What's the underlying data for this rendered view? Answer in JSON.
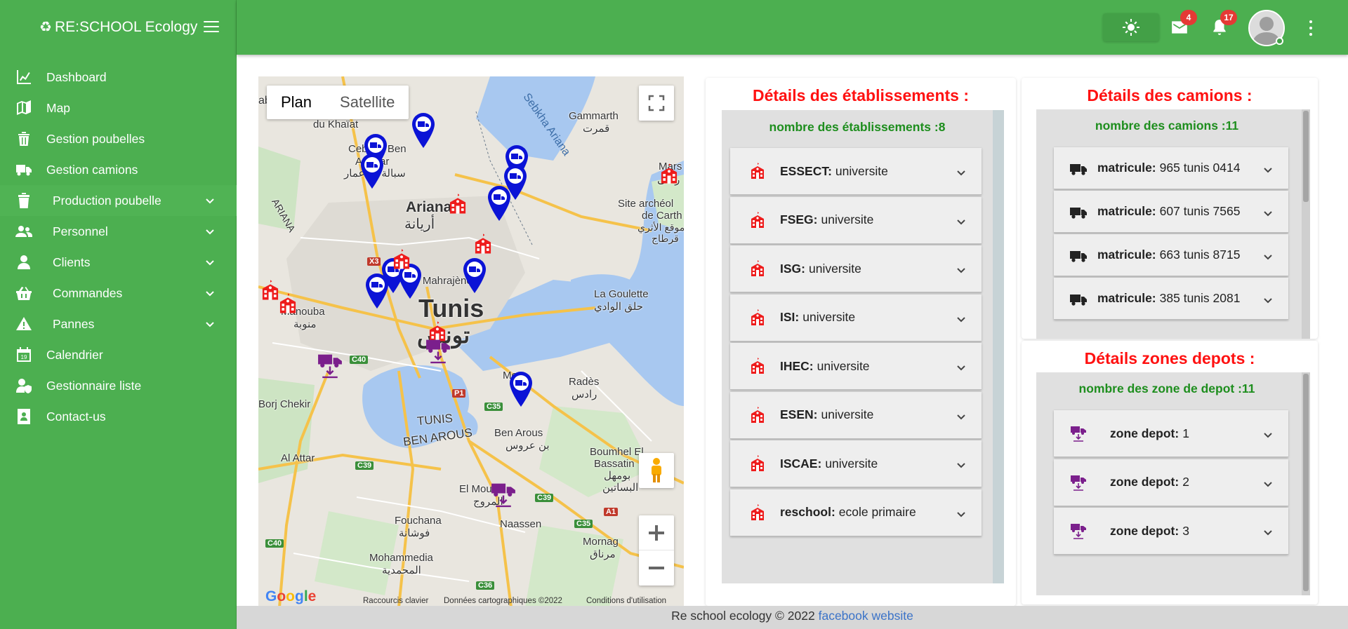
{
  "brand": {
    "title": "RE:SCHOOL Ecology",
    "icon": "recycle-icon"
  },
  "sidebar": {
    "items": [
      {
        "label": "Dashboard",
        "icon": "chart-line-icon"
      },
      {
        "label": "Map",
        "icon": "map-icon"
      },
      {
        "label": "Gestion poubelles",
        "icon": "trash-icon"
      },
      {
        "label": "Gestion camions",
        "icon": "truck-icon"
      },
      {
        "label": "Production poubelle",
        "icon": "trash-alt-icon",
        "expandable": true
      },
      {
        "label": "Personnel",
        "icon": "users-icon",
        "expandable": true
      },
      {
        "label": "Clients",
        "icon": "user-icon",
        "expandable": true
      },
      {
        "label": "Commandes",
        "icon": "basket-icon",
        "expandable": true
      },
      {
        "label": "Pannes",
        "icon": "warning-icon",
        "expandable": true
      },
      {
        "label": "Calendrier",
        "icon": "calendar-icon"
      },
      {
        "label": "Gestionnaire liste",
        "icon": "user-shield-icon"
      },
      {
        "label": "Contact-us",
        "icon": "contact-icon"
      }
    ]
  },
  "topbar": {
    "mail_count": "4",
    "notification_count": "17"
  },
  "map": {
    "toggle_plan": "Plan",
    "toggle_satellite": "Satellite",
    "footer_shortcuts": "Raccourcis clavier",
    "footer_data": "Données cartographiques ©2022",
    "footer_terms": "Conditions d'utilisation",
    "google": "Google",
    "places": {
      "ariana": "Ariana",
      "ariana_ar": "أريانة",
      "tunis": "Tunis",
      "tunis_ar": "تونس",
      "gammarth": "Gammarth",
      "gammarth_ar": "قمرت",
      "sebkha": "Sebkha Ariana",
      "cite": "Cité Mahrajène",
      "goulette": "La Goulette",
      "goulette_ar": "حلق الوادي",
      "manouba": "Manouba",
      "manouba_ar": "منوبة",
      "borj": "Borj Chekir",
      "radès": "Radès",
      "radès_ar": "رادس",
      "tunis_ben": "TUNIS",
      "ben_arous_cap": "BEN AROUS",
      "ben_arous": "Ben Arous",
      "ben_arous_ar": "بن عروس",
      "attar": "Al Attar",
      "boumhel": "Boumhel El",
      "bassatine": "Bassatin",
      "boumhel_ar": "بومهل",
      "bassatine_ar": "البساتين",
      "mourouj": "El Mou",
      "mourouj_ar": "المروج",
      "naassen": "Naassen",
      "fouchana": "Fouchana",
      "fouchana_ar": "فوشانة",
      "mornag": "Mornag",
      "mornag_ar": "مرناق",
      "mohammedia": "Mohammedia",
      "mohammedia_ar": "المحمدية",
      "marsa": "Mars",
      "marsa_ar": "رسى",
      "khaitt": "du Khaïat",
      "cebalat": "Cebalat Ben",
      "ammar": "Ammar",
      "ammar_ar": "سبالة بن عمار",
      "site": "Site archéol",
      "carth": "de Carth",
      "site_ar": "موقع الأثري",
      "site_ar2": "قرطاج",
      "ab": "ab",
      "ariana_side": "ARIANA",
      "mong": "Mo",
      "mong2": "e"
    },
    "roads": [
      "X3",
      "C40",
      "P1",
      "C35",
      "C39",
      "C39",
      "C35",
      "A1",
      "C40",
      "C36"
    ]
  },
  "etablissements": {
    "title": "Détails des établissements :",
    "count": "nombre des établissements :8",
    "items": [
      {
        "key": "ESSECT:",
        "value": "universite"
      },
      {
        "key": "FSEG:",
        "value": "universite"
      },
      {
        "key": "ISG:",
        "value": "universite"
      },
      {
        "key": "ISI:",
        "value": "universite"
      },
      {
        "key": "IHEC:",
        "value": "universite"
      },
      {
        "key": "ESEN:",
        "value": "universite"
      },
      {
        "key": "ISCAE:",
        "value": "universite"
      },
      {
        "key": "reschool:",
        "value": "ecole primaire"
      }
    ]
  },
  "camions": {
    "title": "Détails des camions :",
    "count": "nombre des camions :11",
    "items": [
      {
        "key": "matricule:",
        "value": "965 tunis 0414"
      },
      {
        "key": "matricule:",
        "value": "607 tunis 7565"
      },
      {
        "key": "matricule:",
        "value": "663 tunis 8715"
      },
      {
        "key": "matricule:",
        "value": "385 tunis 2081"
      }
    ]
  },
  "depots": {
    "title": "Détails zones depots :",
    "count": "nombre des zone de depot :11",
    "items": [
      {
        "key": "zone depot:",
        "value": "1"
      },
      {
        "key": "zone depot:",
        "value": "2"
      },
      {
        "key": "zone depot:",
        "value": "3"
      }
    ]
  },
  "footer": {
    "text": "Re school ecology © 2022",
    "link": "facebook website"
  },
  "colors": {
    "primary": "#4caf50",
    "title_red": "#ff1111",
    "count_green": "#1e8e1e",
    "marker_blue": "#0b13d6",
    "marker_red": "#ee1c1c",
    "marker_purple": "#7b1f8c"
  }
}
